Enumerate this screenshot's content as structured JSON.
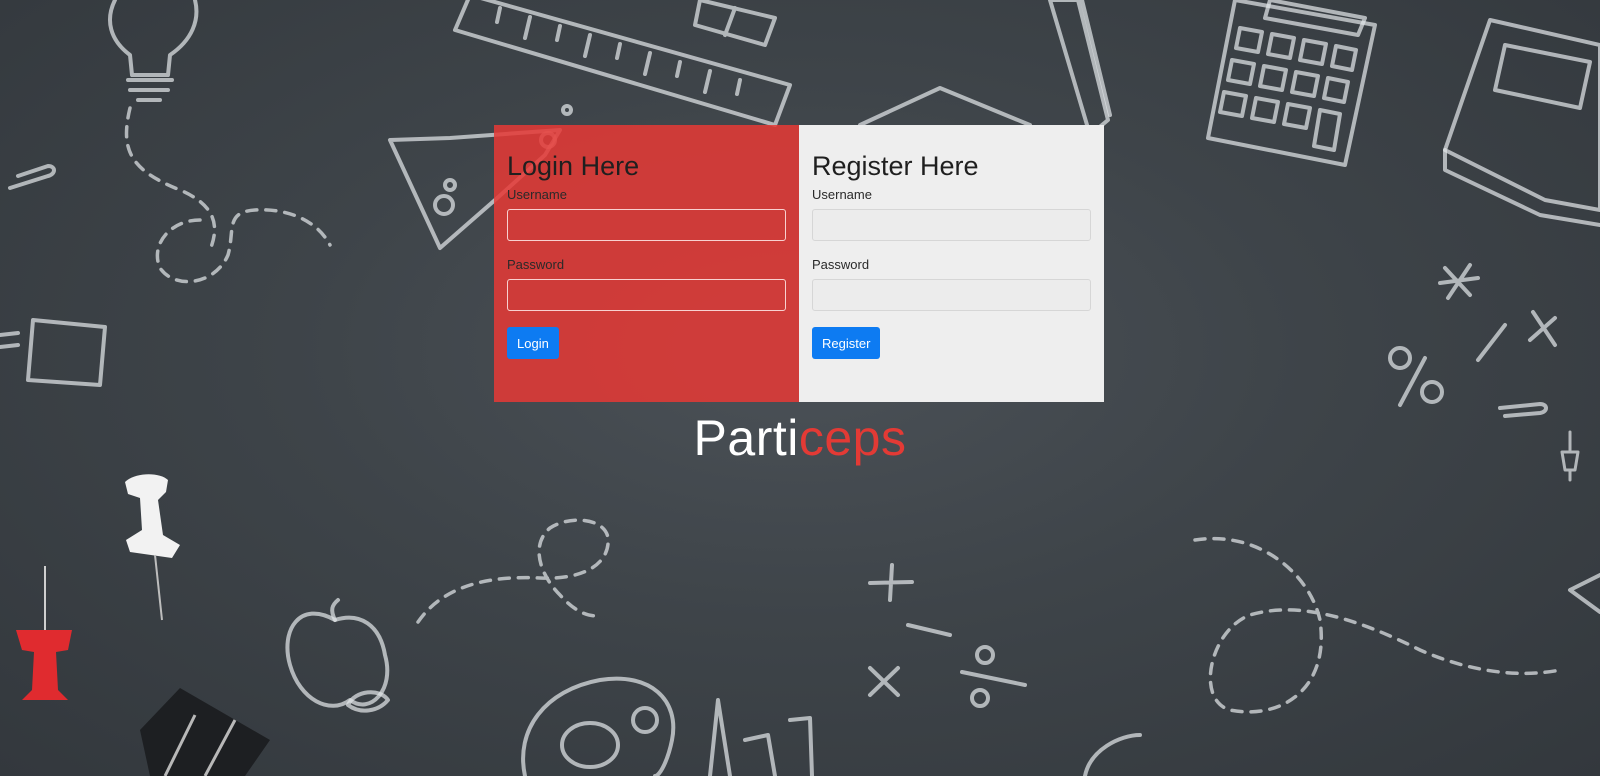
{
  "login": {
    "heading": "Login Here",
    "username_label": "Username",
    "password_label": "Password",
    "button_label": "Login"
  },
  "register": {
    "heading": "Register Here",
    "username_label": "Username",
    "password_label": "Password",
    "button_label": "Register"
  },
  "brand": {
    "part1": "Parti",
    "part2": "ceps"
  },
  "colors": {
    "login_panel": "#e53935",
    "register_panel": "#eeeeee",
    "button": "#0d7bf2",
    "brand_accent": "#e33a35",
    "background": "#3e4449"
  },
  "background_icons": [
    "lightbulb-icon",
    "ruler-icon",
    "eraser-icon",
    "pencil-icon",
    "calculator-icon",
    "book-icon",
    "flask-icon",
    "graduation-cap-icon",
    "paperclip-icon",
    "pushpin-icon",
    "binder-clip-icon",
    "apple-icon",
    "palette-icon",
    "paint-tube-icon",
    "math-symbols-icon"
  ]
}
